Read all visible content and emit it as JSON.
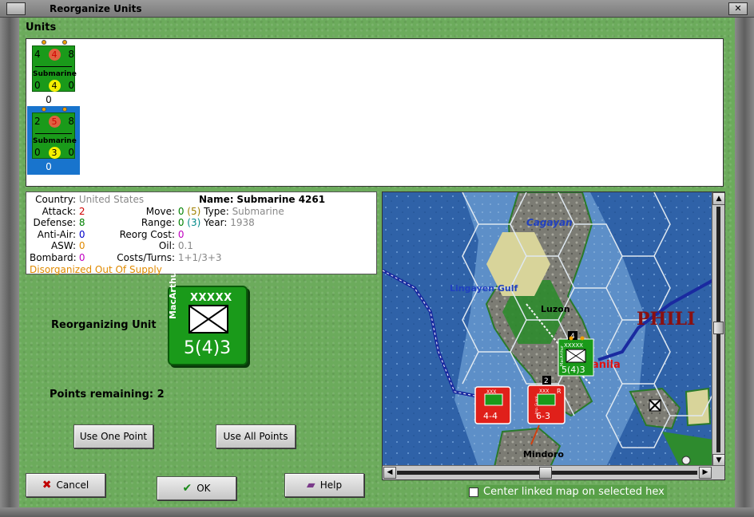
{
  "window": {
    "title": "Reorganize Units"
  },
  "units": {
    "label": "Units",
    "cards": [
      {
        "top_left": "4",
        "top_mid": "4",
        "top_right": "8",
        "name": "Submarine",
        "bot_left": "0",
        "bot_mid": "4",
        "bot_right": "0",
        "count": "0",
        "selected": false
      },
      {
        "top_left": "2",
        "top_mid": "5",
        "top_right": "8",
        "name": "Submarine",
        "bot_left": "0",
        "bot_mid": "3",
        "bot_right": "0",
        "count": "0",
        "selected": true
      }
    ]
  },
  "info": {
    "country_k": "Country:",
    "country_v": "United States",
    "attack_k": "Attack:",
    "attack_v": "2",
    "defense_k": "Defense:",
    "defense_v": "8",
    "antiair_k": "Anti-Air:",
    "antiair_v": "0",
    "asw_k": "ASW:",
    "asw_v": "0",
    "bombard_k": "Bombard:",
    "bombard_v": "0",
    "supply": "Disorganized Out Of Supply",
    "name_k": "Name:",
    "name_v": "Submarine 4261",
    "move_k": "Move:",
    "move_v": "0",
    "move_max": "(5)",
    "type_k": "Type:",
    "type_v": "Submarine",
    "range_k": "Range:",
    "range_v": "0",
    "range_max": "(3)",
    "year_k": "Year:",
    "year_v": "1938",
    "reorg_k": "Reorg Cost:",
    "reorg_v": "0",
    "oil_k": "Oil:",
    "oil_v": "0.1",
    "costs_k": "Costs/Turns:",
    "costs_v": "1+1/3+3"
  },
  "reorganizing": {
    "label": "Reorganizing Unit",
    "size": "XXXXX",
    "commander": "MacArthur",
    "strength": "5(4)3"
  },
  "points": {
    "label": "Points remaining:",
    "value": "2"
  },
  "buttons": {
    "use_one": "Use One Point",
    "use_all": "Use All Points",
    "cancel": "Cancel",
    "ok": "OK",
    "help": "Help"
  },
  "map": {
    "labels": {
      "cagayan": "Cagayan",
      "lingayen": "Lingayen Gulf",
      "luzon": "Luzon",
      "phil": "PHILI",
      "manila": "anila",
      "mindoro": "Mindoro"
    },
    "units": [
      {
        "commander": "MacArthur",
        "size": "XXXXX",
        "strength": "5(4)3",
        "stack": "4"
      },
      {
        "size": "XXX",
        "strength": "4-4"
      },
      {
        "size": "XXX",
        "strength": "6-3",
        "stack": "2",
        "tag": "R",
        "commander": "Imp. Guard"
      }
    ]
  },
  "center_link": {
    "label": "Center linked map on selected hex"
  },
  "colors": {
    "felt": "#6cab5c",
    "counter_green": "#1a9a1a",
    "axis_red": "#e0201a",
    "selection": "#1874cd"
  }
}
